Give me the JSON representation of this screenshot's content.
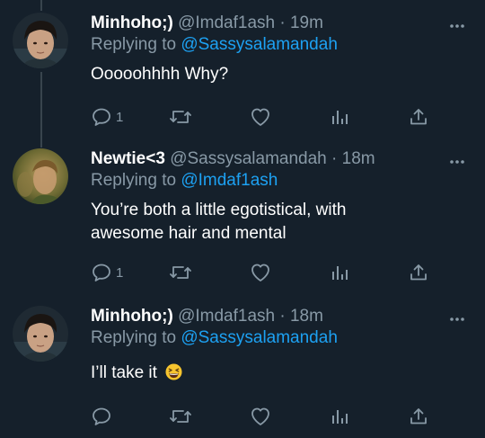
{
  "tweets": [
    {
      "display_name": "Minhoho;)",
      "handle": "@Imdaf1ash",
      "separator": "·",
      "time": "19m",
      "replying_prefix": "Replying to",
      "replying_to": "@Sassysalamandah",
      "text": "Ooooohhhh Why?",
      "reply_count": "1",
      "avatar": "minho-avatar"
    },
    {
      "display_name": "Newtie<3",
      "handle": "@Sassysalamandah",
      "separator": "·",
      "time": "18m",
      "replying_prefix": "Replying to",
      "replying_to": "@Imdaf1ash",
      "text_line1": "You’re both a little egotistical, with",
      "text_line2": "awesome hair and mental",
      "reply_count": "1",
      "avatar": "newt-avatar"
    },
    {
      "display_name": "Minhoho;)",
      "handle": "@Imdaf1ash",
      "separator": "·",
      "time": "18m",
      "replying_prefix": "Replying to",
      "replying_to": "@Sassysalamandah",
      "text": "I’ll take it",
      "emoji": "grinning-squinting-face-emoji",
      "reply_count": "",
      "avatar": "minho-avatar"
    }
  ],
  "icons": {
    "reply": "reply-icon",
    "retweet": "retweet-icon",
    "like": "heart-icon",
    "analytics": "analytics-icon",
    "share": "share-icon",
    "more": "more-icon"
  },
  "colors": {
    "background": "#15202b",
    "text": "#ffffff",
    "muted": "#8899a6",
    "link": "#1da1f2",
    "thread_line": "#38444d"
  }
}
